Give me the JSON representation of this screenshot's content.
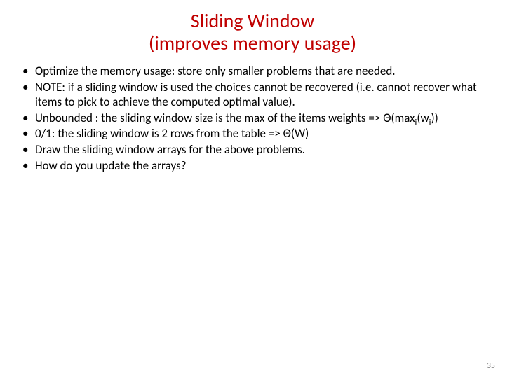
{
  "title_line1": "Sliding Window",
  "title_line2": "(improves memory usage)",
  "bullets": {
    "b0": "Optimize the memory usage: store only smaller problems that are needed.",
    "b1": "NOTE: if a sliding window is used the choices cannot be recovered (i.e. cannot recover what items to pick to achieve the computed optimal value).",
    "b2_pre": "Unbounded : the sliding window size is the max of the items weights => Θ(max",
    "b2_sub1": "i",
    "b2_mid": "(w",
    "b2_sub2": "i",
    "b2_post": "))",
    "b3": "0/1: the sliding window is 2 rows from the table => Θ(W)",
    "b4": "Draw the sliding window arrays for the above problems.",
    "b5": "How do you update the arrays?"
  },
  "page_number": "35"
}
